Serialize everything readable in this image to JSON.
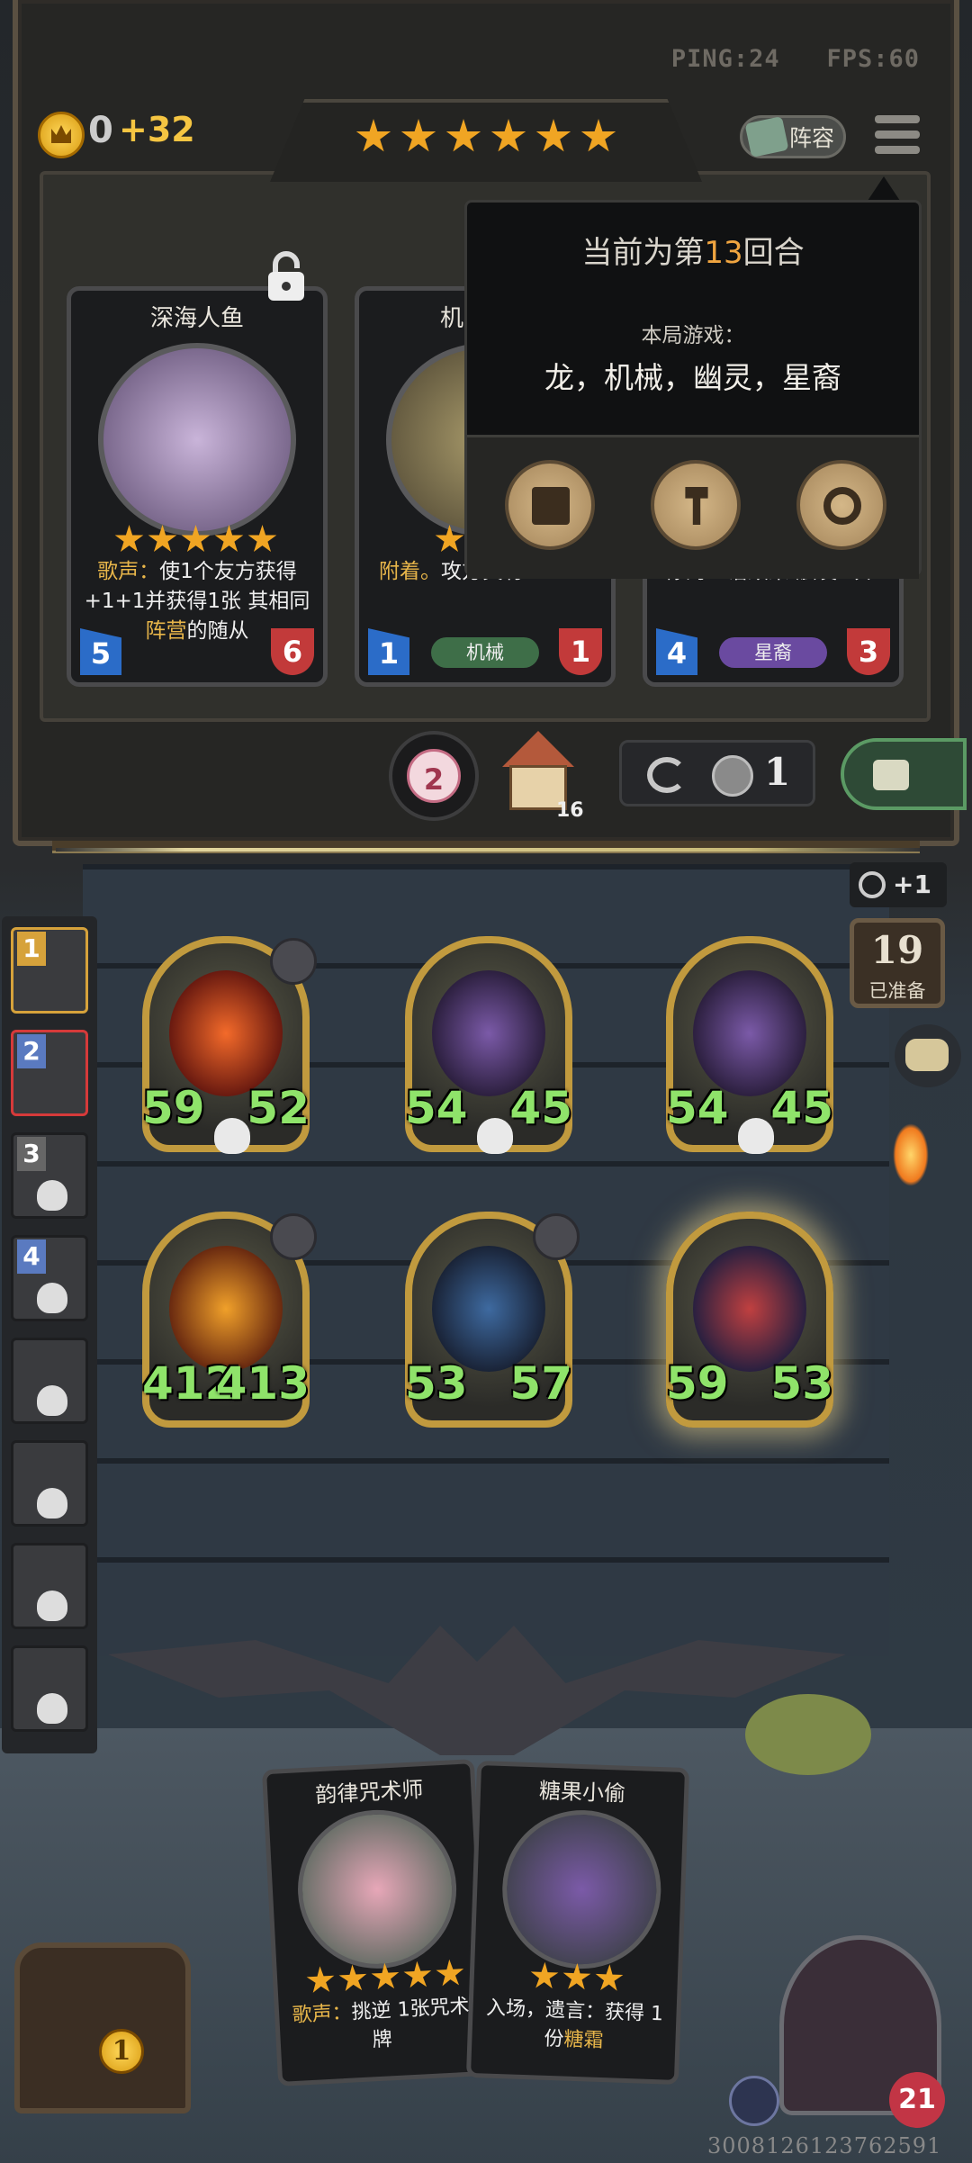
{
  "hud": {
    "ping": "PING:24",
    "fps": "FPS:60",
    "gold": "0",
    "gold_income": "+32",
    "tavern_stars": 6,
    "lineup_label": "阵容",
    "menu_icon": "hamburger-icon"
  },
  "shop": {
    "cards": [
      {
        "name": "深海人鱼",
        "stars": 5,
        "desc_prefix": "歌声：",
        "desc_main": "使1个友方获得 +1+1并获得1张 其相同",
        "desc_highlight": "阵营",
        "desc_suffix": "的随从",
        "attack": "5",
        "health": "6",
        "tribe": "",
        "locked_icon": "padlock-icon"
      },
      {
        "name": "机",
        "stars": 1,
        "desc_prefix": "附着。",
        "desc_main": "攻方真有 +2+2",
        "attack": "1",
        "health": "1",
        "tribe": "机械"
      },
      {
        "name": "",
        "stars": 0,
        "desc_main": "你的亡语效果 触发2次*",
        "attack": "4",
        "health": "3",
        "tribe": "星裔"
      }
    ],
    "refresh_dice": "2",
    "upgrade_cost": "16",
    "refresh_cost": "1"
  },
  "popup": {
    "round_prefix": "当前为第",
    "round_num": "13",
    "round_suffix": "回合",
    "game_label": "本局游戏：",
    "tribes": "龙，机械，幽灵，星裔",
    "buttons": [
      "rulebook-icon",
      "hammer-icon",
      "gear-icon"
    ]
  },
  "board": {
    "minions": [
      {
        "attack": "59",
        "health": "52",
        "tribe": "dragon"
      },
      {
        "attack": "54",
        "health": "45",
        "tribe": "ghost"
      },
      {
        "attack": "54",
        "health": "45",
        "tribe": "ghost"
      },
      {
        "attack": "412",
        "health": "413",
        "tribe": "dragon"
      },
      {
        "attack": "53",
        "health": "57",
        "tribe": "dragon"
      },
      {
        "attack": "59",
        "health": "53",
        "tribe": "star"
      }
    ]
  },
  "ladder": {
    "ranks": [
      "1",
      "2",
      "3",
      "4",
      "",
      "",
      "",
      ""
    ]
  },
  "ready": {
    "plus": "+1",
    "count": "19",
    "label": "已准备"
  },
  "hand": {
    "cards": [
      {
        "name": "韵律咒术师",
        "stars": 5,
        "desc_prefix": "歌声：",
        "desc_main": "挑逆 1张咒术牌"
      },
      {
        "name": "糖果小偷",
        "stars": 3,
        "desc_prefix": "入场，遗言：",
        "desc_main": "获得 1份",
        "desc_highlight": "糖霜"
      }
    ]
  },
  "player": {
    "chest_coin": "1",
    "hero_health": "21",
    "id": "3008126123762591"
  }
}
